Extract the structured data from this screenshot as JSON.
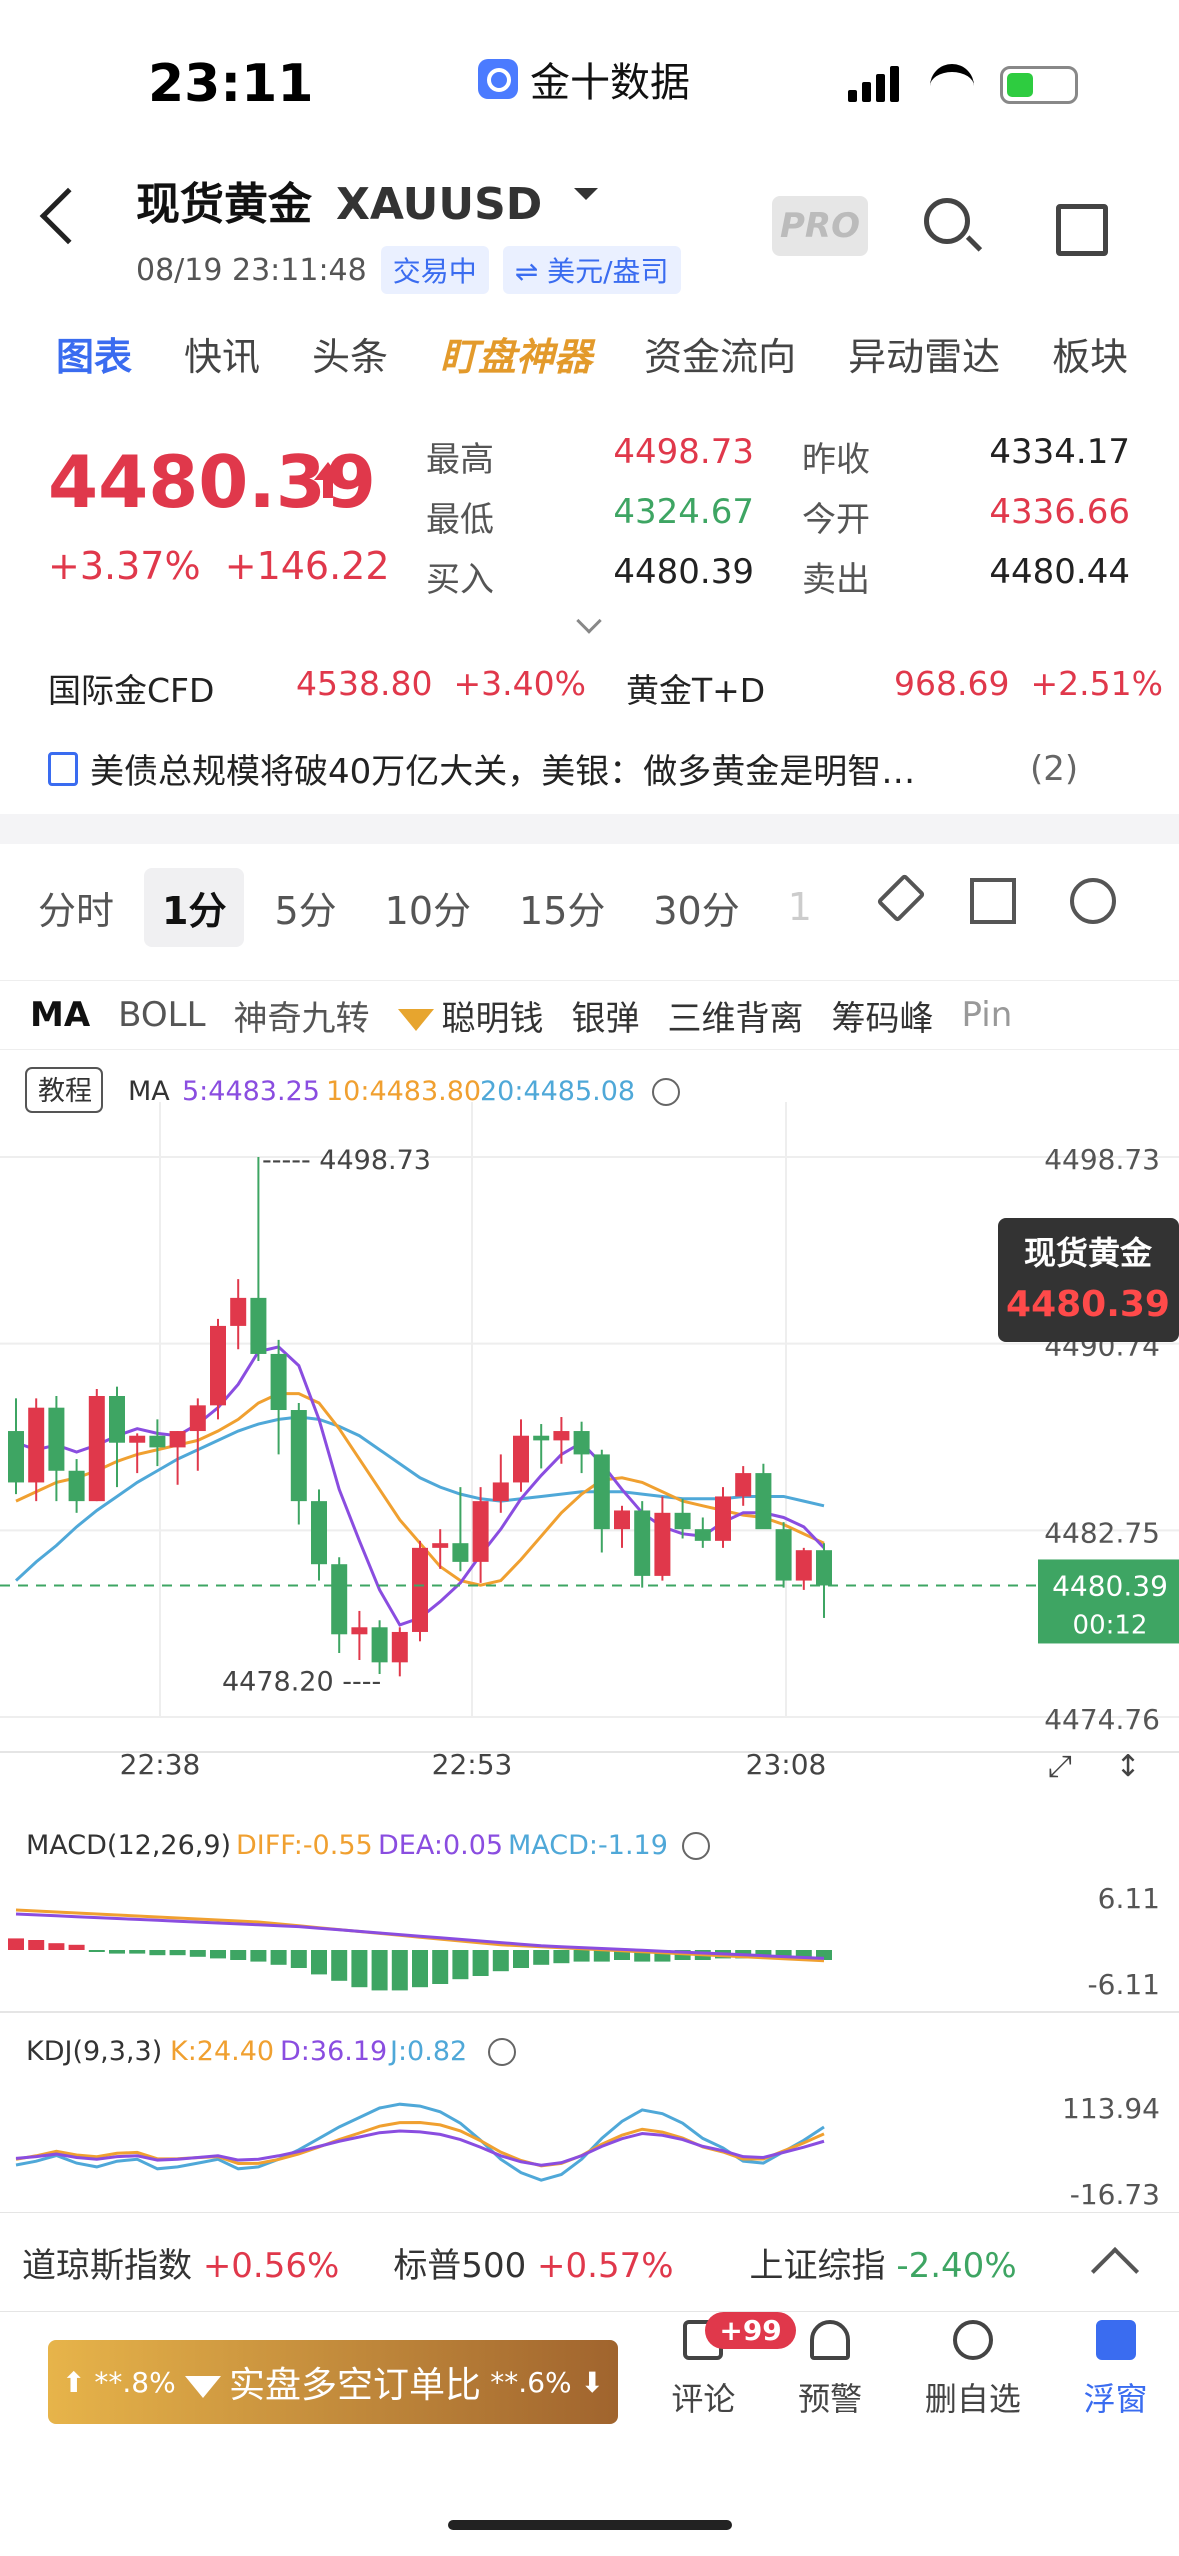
{
  "status": {
    "time": "23:11",
    "app": "金十数据"
  },
  "header": {
    "name": "现货黄金",
    "symbol": "XAUUSD",
    "datetime": "08/19 23:11:48",
    "trading": "交易中",
    "currency": "⇌ 美元/盎司",
    "pro": "PRO"
  },
  "tabs": [
    "图表",
    "快讯",
    "头条",
    "盯盘神器",
    "资金流向",
    "异动雷达",
    "板块"
  ],
  "quote": {
    "price": "4480.39",
    "pct": "+3.37%",
    "chg": "+146.22",
    "high_label": "最高",
    "high": "4498.73",
    "low_label": "最低",
    "low": "4324.67",
    "bid_label": "买入",
    "bid": "4480.39",
    "prev_label": "昨收",
    "prev": "4334.17",
    "open_label": "今开",
    "open": "4336.66",
    "ask_label": "卖出",
    "ask": "4480.44"
  },
  "related": {
    "a_name": "国际金CFD",
    "a_price": "4538.80",
    "a_pct": "+3.40%",
    "b_name": "黄金T+D",
    "b_price": "968.69",
    "b_pct": "+2.51%"
  },
  "news": {
    "text": "美债总规模将破40万亿大关，美银：做多黄金是明智…",
    "count": "(2)"
  },
  "periods": [
    "分时",
    "1分",
    "5分",
    "10分",
    "15分",
    "30分",
    "1"
  ],
  "indicators": [
    "MA",
    "BOLL",
    "神奇九转",
    "聪明钱",
    "银弹",
    "三维背离",
    "筹码峰",
    "Pin"
  ],
  "chart_data": {
    "type": "candlestick",
    "tutorial": "教程",
    "ma_legend": {
      "label": "MA",
      "ma5": "5:4483.25",
      "ma10": "10:4483.80",
      "ma20": "20:4485.08"
    },
    "price_ticks": [
      "4498.73",
      "4490.74",
      "4482.75",
      "4474.76"
    ],
    "hi_mark": "4498.73",
    "lo_mark": "4478.20",
    "label_name": "现货黄金",
    "label_price": "4480.39",
    "last_price": "4480.39",
    "countdown": "00:12",
    "time_ticks": [
      "22:38",
      "22:53",
      "23:08"
    ],
    "ylim": [
      4474.76,
      4498.73
    ],
    "candles": [
      [
        4487.0,
        4488.4,
        4484.3,
        4484.8
      ],
      [
        4484.8,
        4488.4,
        4484.0,
        4488.0
      ],
      [
        4488.0,
        4488.5,
        4484.0,
        4485.3
      ],
      [
        4485.3,
        4485.8,
        4483.5,
        4484.0
      ],
      [
        4484.0,
        4488.8,
        4484.0,
        4488.5
      ],
      [
        4488.5,
        4488.9,
        4484.6,
        4486.5
      ],
      [
        4486.5,
        4486.9,
        4485.2,
        4486.8
      ],
      [
        4486.8,
        4487.5,
        4485.5,
        4486.3
      ],
      [
        4486.3,
        4487.0,
        4484.7,
        4487.0
      ],
      [
        4487.0,
        4488.4,
        4485.3,
        4488.1
      ],
      [
        4488.1,
        4491.8,
        4487.5,
        4491.5
      ],
      [
        4491.5,
        4493.5,
        4490.5,
        4492.7
      ],
      [
        4492.7,
        4498.73,
        4490.0,
        4490.3
      ],
      [
        4490.3,
        4490.9,
        4486.0,
        4487.9
      ],
      [
        4487.9,
        4488.2,
        4483.0,
        4484.0
      ],
      [
        4484.0,
        4484.5,
        4480.6,
        4481.3
      ],
      [
        4481.3,
        4481.6,
        4477.5,
        4478.3
      ],
      [
        4478.3,
        4479.3,
        4477.2,
        4478.6
      ],
      [
        4478.6,
        4478.9,
        4476.6,
        4477.1
      ],
      [
        4477.1,
        4478.6,
        4476.5,
        4478.4
      ],
      [
        4478.4,
        4482.3,
        4478.0,
        4482.0
      ],
      [
        4482.0,
        4482.8,
        4481.1,
        4482.2
      ],
      [
        4482.2,
        4484.6,
        4481.0,
        4481.4
      ],
      [
        4481.4,
        4484.6,
        4480.5,
        4484.0
      ],
      [
        4484.0,
        4486.0,
        4483.5,
        4484.8
      ],
      [
        4484.8,
        4487.5,
        4484.4,
        4486.8
      ],
      [
        4486.8,
        4487.3,
        4485.4,
        4486.6
      ],
      [
        4486.6,
        4487.6,
        4485.6,
        4487.0
      ],
      [
        4487.0,
        4487.4,
        4485.2,
        4486.0
      ],
      [
        4486.0,
        4486.2,
        4481.8,
        4482.8
      ],
      [
        4482.8,
        4483.8,
        4482.0,
        4483.6
      ],
      [
        4483.6,
        4484.0,
        4480.3,
        4480.8
      ],
      [
        4480.8,
        4484.2,
        4480.6,
        4483.5
      ],
      [
        4483.5,
        4484.1,
        4482.4,
        4482.8
      ],
      [
        4482.8,
        4483.3,
        4482.0,
        4482.3
      ],
      [
        4482.3,
        4484.6,
        4482.0,
        4484.2
      ],
      [
        4484.2,
        4485.5,
        4483.8,
        4485.2
      ],
      [
        4485.2,
        4485.6,
        4482.9,
        4482.8
      ],
      [
        4482.8,
        4483.1,
        4480.3,
        4480.6
      ],
      [
        4480.6,
        4482.0,
        4480.2,
        4481.9
      ],
      [
        4481.9,
        4482.2,
        4479.0,
        4480.39
      ]
    ],
    "ma5": [
      4486.5,
      4486.2,
      4486.4,
      4486.1,
      4486.4,
      4486.8,
      4487.1,
      4486.9,
      4486.8,
      4487.3,
      4488.0,
      4489.0,
      4490.4,
      4490.6,
      4489.8,
      4487.5,
      4484.5,
      4482.3,
      4480.2,
      4478.7,
      4479.0,
      4479.7,
      4480.5,
      4481.7,
      4482.8,
      4484.1,
      4485.1,
      4486.0,
      4486.5,
      4485.6,
      4484.5,
      4483.5,
      4482.9,
      4482.6,
      4482.5,
      4483.1,
      4483.5,
      4483.5,
      4483.3,
      4482.9,
      4482.0
    ],
    "ma10": [
      4484.0,
      4484.4,
      4484.8,
      4485.0,
      4485.3,
      4485.7,
      4486.0,
      4486.2,
      4486.4,
      4486.6,
      4487.0,
      4487.5,
      4488.2,
      4488.6,
      4488.6,
      4488.2,
      4487.1,
      4485.8,
      4484.5,
      4483.2,
      4482.2,
      4481.2,
      4480.6,
      4480.4,
      4480.6,
      4481.5,
      4482.5,
      4483.5,
      4484.3,
      4484.9,
      4485.0,
      4484.8,
      4484.4,
      4484.0,
      4483.8,
      4483.6,
      4483.4,
      4483.3,
      4483.0,
      4482.6,
      4482.2
    ],
    "ma20": [
      4480.6,
      4481.4,
      4482.1,
      4482.9,
      4483.6,
      4484.2,
      4484.8,
      4485.3,
      4485.8,
      4486.2,
      4486.6,
      4487.0,
      4487.3,
      4487.5,
      4487.6,
      4487.5,
      4487.2,
      4486.8,
      4486.2,
      4485.6,
      4485.0,
      4484.6,
      4484.3,
      4484.1,
      4484.0,
      4484.1,
      4484.2,
      4484.3,
      4484.4,
      4484.4,
      4484.4,
      4484.3,
      4484.2,
      4484.1,
      4484.1,
      4484.1,
      4484.2,
      4484.2,
      4484.2,
      4484.0,
      4483.8
    ],
    "macd": {
      "legend": "MACD(12,26,9)",
      "diff": "DIFF:-0.55",
      "dea": "DEA:0.05",
      "macd": "MACD:-1.19",
      "ticks": [
        "6.11",
        "-6.11"
      ]
    },
    "kdj": {
      "legend": "KDJ(9,3,3)",
      "k": "K:24.40",
      "d": "D:36.19",
      "j": "J:0.82",
      "ticks": [
        "113.94",
        "-16.73"
      ]
    },
    "colors": {
      "up": "#e0384b",
      "down": "#3ea563",
      "ma5": "#8a4de0",
      "ma10": "#f0a030",
      "ma20": "#4fa8d8"
    }
  },
  "indices": [
    {
      "name": "道琼斯指数",
      "val": "+0.56%"
    },
    {
      "name": "标普500",
      "val": "+0.57%"
    },
    {
      "name": "上证综指",
      "val": "-2.40%"
    }
  ],
  "cta": {
    "left": "⬆ **.8%",
    "mid": "实盘多空订单比",
    "right": "**.6% ⬇"
  },
  "actions": [
    {
      "label": "评论",
      "badge": "+99"
    },
    {
      "label": "预警"
    },
    {
      "label": "删自选"
    },
    {
      "label": "浮窗"
    }
  ]
}
